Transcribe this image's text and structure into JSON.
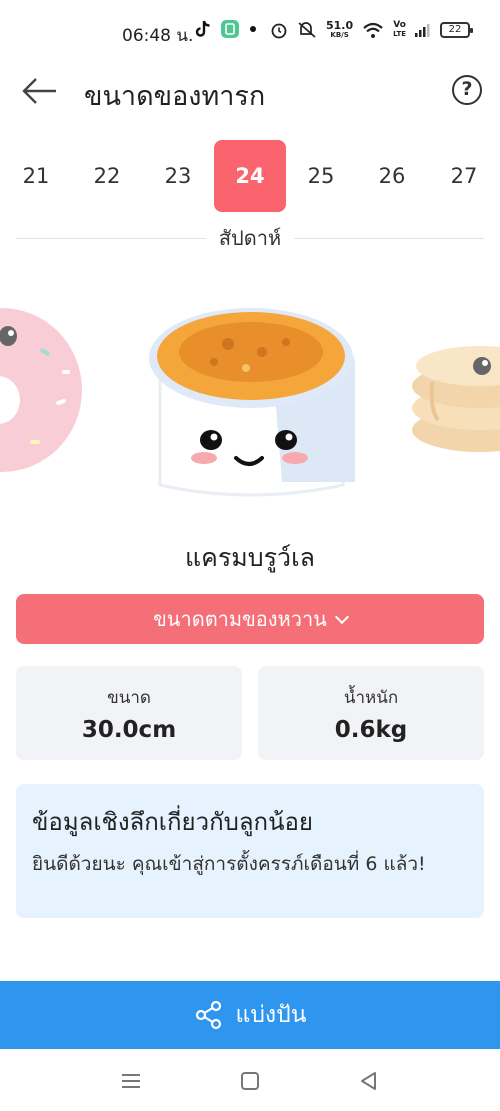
{
  "status_bar": {
    "time": "06:48 น.",
    "net_speed_value": "51.0",
    "net_speed_unit": "KB/S",
    "volte_top": "Vo",
    "volte_bottom": "LTE",
    "battery": "22"
  },
  "header": {
    "title": "ขนาดของทารก",
    "help_glyph": "?"
  },
  "weeks": {
    "items": [
      "21",
      "22",
      "23",
      "24",
      "25",
      "26",
      "27"
    ],
    "selected": "24",
    "caption": "สัปดาห์"
  },
  "illustration": {
    "current_food": "แครมบรูว์เล",
    "icons": [
      "donut-icon",
      "creme-brulee-icon",
      "pancake-icon"
    ]
  },
  "compare": {
    "label": "ขนาดตามของหวาน",
    "color": "#f46f77"
  },
  "stats": {
    "size_label": "ขนาด",
    "size_value": "30.0cm",
    "weight_label": "น้ำหนัก",
    "weight_value": "0.6kg"
  },
  "insight": {
    "title": "ข้อมูลเชิงลึกเกี่ยวกับลูกน้อย",
    "body": "ยินดีด้วยนะ คุณเข้าสู่การตั้งครรภ์เดือนที่ 6 แล้ว!"
  },
  "share": {
    "label": "แบ่งปัน",
    "color": "#2f96ef"
  },
  "colors": {
    "accent": "#f9646e",
    "card_bg": "#f2f3f6",
    "insight_bg": "#e6f2fd"
  }
}
